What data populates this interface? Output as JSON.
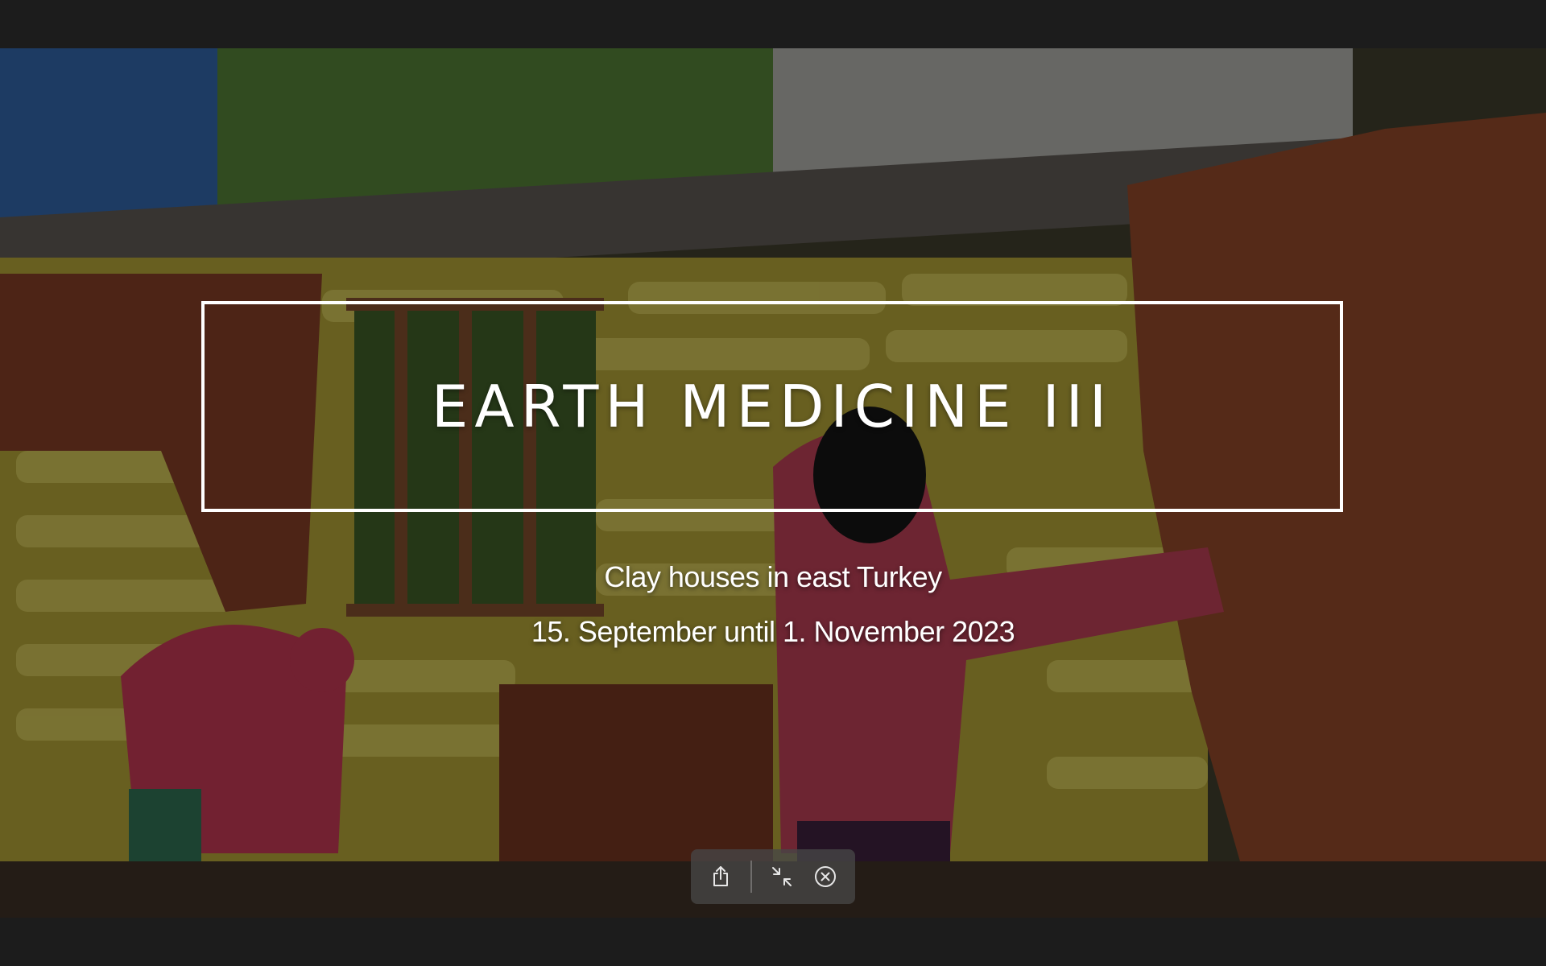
{
  "slide": {
    "title": "EARTH MEDICINE III",
    "subtitle": "Clay houses in east Turkey",
    "dates": "15. September until 1. November 2023"
  },
  "photo": {
    "subject": "women plastering clay walls",
    "palette": {
      "clay": "#7a3a22",
      "bags": "#b8a93a",
      "foliage": "#4b6a2e",
      "sky": "#9a9a9a",
      "shirt": "#c2405a"
    }
  },
  "toolbar": {
    "buttons": [
      {
        "name": "share-button",
        "icon": "share-icon"
      },
      {
        "name": "exit-fullscreen-button",
        "icon": "collapse-arrows-icon"
      },
      {
        "name": "close-button",
        "icon": "close-circle-icon"
      }
    ]
  }
}
